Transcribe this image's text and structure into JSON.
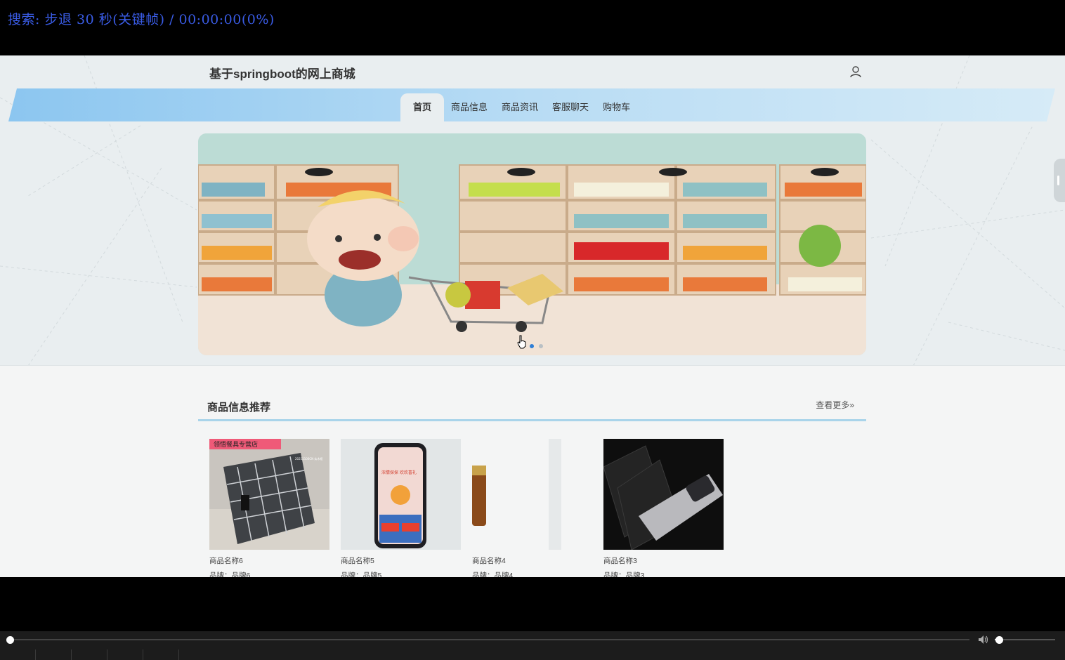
{
  "player": {
    "osd_text": "搜索: 步退 30 秒(关键帧) / 00:00:00(0%)",
    "progress": 0,
    "volume": 0.07,
    "accent": "#3a5ce6"
  },
  "site": {
    "title": "基于springboot的网上商城",
    "user_icon": "user-icon",
    "nav": [
      {
        "label": "首页",
        "active": true
      },
      {
        "label": "商品信息",
        "active": false
      },
      {
        "label": "商品资讯",
        "active": false
      },
      {
        "label": "客服聊天",
        "active": false
      },
      {
        "label": "购物车",
        "active": false
      }
    ],
    "nav_band_color": "#9ccbf0"
  },
  "carousel": {
    "slide_count": 2,
    "active_index": 0
  },
  "recommend": {
    "title": "商品信息推荐",
    "more_label": "查看更多",
    "more_icon": "double-chevron-right-icon",
    "products": [
      {
        "name": "商品名称6",
        "brand": "品牌：品牌6",
        "tag": "领悟餐具专营店",
        "tag_small": "20211106CN 实木框"
      },
      {
        "name": "商品名称5",
        "brand": "品牌：品牌5",
        "screen_text": "浓情探探 欢欢喜礼"
      },
      {
        "name": "商品名称4",
        "brand": "品牌：品牌4"
      },
      {
        "name": "商品名称3",
        "brand": "品牌：品牌3"
      }
    ]
  }
}
